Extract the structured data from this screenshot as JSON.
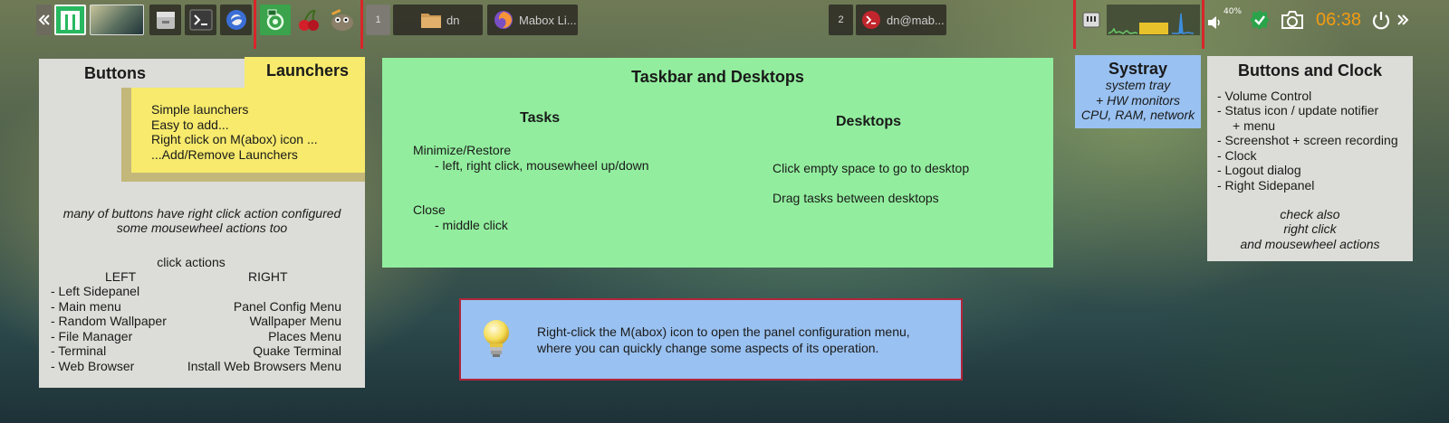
{
  "colors": {
    "taskbar_dark": "#2d2a24",
    "separator_red": "#d9262a",
    "clock_orange": "#f39c12",
    "note_gray": "#dcdcd8",
    "note_yellow": "#f7ea6c",
    "note_green": "#92ee9e",
    "note_blue": "#99c1f1",
    "tip_border": "#b1263a"
  },
  "taskbar": {
    "desktop_1": "1",
    "desktop_2": "2",
    "task_dn": "dn",
    "task_browser": "Mabox Li...",
    "task_terminal": "dn@mab...",
    "volume_level": "40%",
    "clock": "06:38"
  },
  "buttons_note": {
    "title": "Buttons",
    "comment_1": "many of buttons have right click action configured",
    "comment_2": "some mousewheel actions too",
    "click_actions": "click actions",
    "left_header": "LEFT",
    "right_header": "RIGHT",
    "rows": [
      {
        "left": "- Left Sidepanel",
        "right": ""
      },
      {
        "left": "- Main menu",
        "right": "Panel Config Menu"
      },
      {
        "left": "- Random Wallpaper",
        "right": "Wallpaper Menu"
      },
      {
        "left": "- File Manager",
        "right": "Places Menu"
      },
      {
        "left": "- Terminal",
        "right": "Quake Terminal"
      },
      {
        "left": "- Web Browser",
        "right": "Install Web Browsers Menu"
      }
    ]
  },
  "launchers_note": {
    "title": "Launchers",
    "lines": [
      "Simple launchers",
      "Easy to add...",
      "Right click on M(abox) icon ...",
      "...Add/Remove Launchers"
    ]
  },
  "taskbar_note": {
    "title": "Taskbar and Desktops",
    "tasks_title": "Tasks",
    "tasks_lines": [
      "Minimize/Restore",
      "- left, right click, mousewheel up/down",
      "Close",
      "- middle click"
    ],
    "desktops_title": "Desktops",
    "desktops_lines": [
      "Click empty space to go to desktop",
      "Drag tasks between desktops"
    ]
  },
  "systray_note": {
    "title": "Systray",
    "lines": [
      "system tray",
      "+ HW monitors",
      "CPU, RAM, network"
    ]
  },
  "clock_note": {
    "title": "Buttons and Clock",
    "lines": [
      "- Volume Control",
      "- Status icon / update notifier",
      "+ menu",
      "- Screenshot + screen recording",
      "- Clock",
      "- Logout dialog",
      "- Right Sidepanel"
    ],
    "footer": [
      "check also",
      "right click",
      "and mousewheel actions"
    ]
  },
  "tip": {
    "line_1": "Right-click the M(abox) icon to open the panel configuration menu,",
    "line_2": "where you can quickly change some aspects of its operation."
  }
}
